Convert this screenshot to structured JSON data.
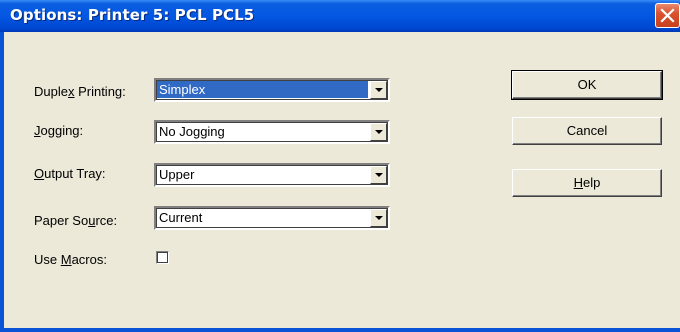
{
  "window": {
    "title": "Options: Printer 5: PCL PCL5"
  },
  "fields": {
    "duplex": {
      "label_pre": "Duple",
      "label_ul": "x",
      "label_post": " Printing:",
      "value": "Simplex"
    },
    "jogging": {
      "label_pre": "",
      "label_ul": "J",
      "label_post": "ogging:",
      "value": "No Jogging"
    },
    "output_tray": {
      "label_pre": "",
      "label_ul": "O",
      "label_post": "utput Tray:",
      "value": "Upper"
    },
    "paper_source": {
      "label_pre": "Paper So",
      "label_ul": "u",
      "label_post": "rce:",
      "value": "Current"
    },
    "use_macros": {
      "label_pre": "Use ",
      "label_ul": "M",
      "label_post": "acros:",
      "checked": false
    }
  },
  "buttons": {
    "ok": "OK",
    "cancel": "Cancel",
    "help_ul": "H",
    "help_rest": "elp"
  },
  "colors": {
    "titlebar": "#0457e3",
    "selection": "#316ac5",
    "face": "#ece9d8",
    "close": "#d8532f"
  }
}
